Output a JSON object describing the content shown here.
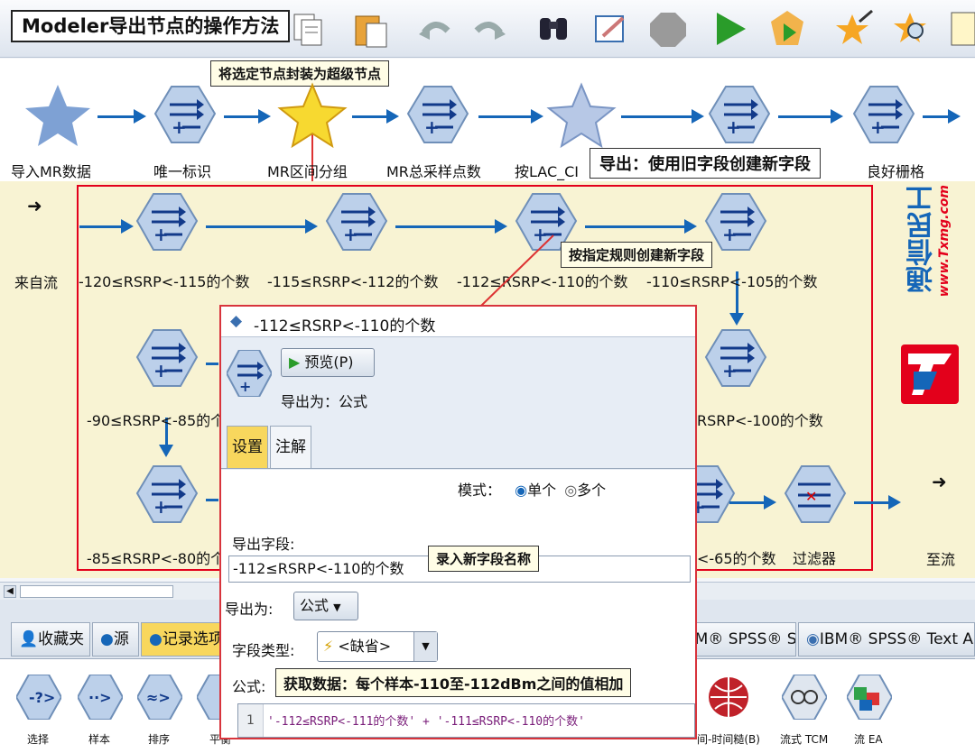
{
  "title": "Modeler导出节点的操作方法",
  "callouts": {
    "supernode": "将选定节点封装为超级节点",
    "derive_old": "导出：使用旧字段创建新字段",
    "rule": "按指定规则创建新字段",
    "enter_name": "录入新字段名称",
    "get_data": "获取数据：每个样本-110至-112dBm之间的值相加"
  },
  "top_nodes": [
    "导入MR数据",
    "唯一标识",
    "MR区间分组",
    "MR总采样点数",
    "按LAC_CI",
    "良好栅格"
  ],
  "canvas": {
    "from_stream": "来自流",
    "to_stream": "至流",
    "row1": [
      "-120≤RSRP<-115的个数",
      "-115≤RSRP<-112的个数",
      "-112≤RSRP<-110的个数",
      "-110≤RSRP<-105的个数"
    ],
    "row2_left": "-90≤RSRP<-85的个",
    "row2_right": "RSRP<-100的个数",
    "row3_left": "-85≤RSRP<-80的个",
    "row3_right": "<-65的个数",
    "filter": "过滤器",
    "watermark": "通信民工",
    "watermark_url": "www.Txmg.com"
  },
  "dialog": {
    "title": "-112≤RSRP<-110的个数",
    "preview_btn": "预览(P)",
    "derive_as_top": "导出为：公式",
    "tabs": [
      "设置",
      "注解"
    ],
    "mode_label": "模式：",
    "mode_single": "单个",
    "mode_multiple": "多个",
    "derive_field_label": "导出字段:",
    "derive_field_value": "-112≤RSRP<-110的个数",
    "derive_as_label": "导出为:",
    "derive_as_value": "公式",
    "field_type_label": "字段类型:",
    "field_type_value": "<缺省>",
    "formula_label": "公式:",
    "formula_line_no": "1",
    "formula": "'-112≤RSRP<-111的个数' + '-111≤RSRP<-110的个数'"
  },
  "palette": {
    "tabs": [
      "收藏夹",
      "源",
      "记录选项"
    ],
    "right_tabs": [
      "IBM® SPSS® Statistics",
      "IBM® SPSS® Text A"
    ],
    "icons": [
      "选择",
      "样本",
      "排序",
      "平衡"
    ],
    "right_icons": [
      "时间-时间糙(B)",
      "流式 TCM",
      "流 EA"
    ]
  },
  "colors": {
    "accent": "#1566b8",
    "highlight_red": "#e3001b",
    "canvas_bg": "#f8f3d3"
  }
}
